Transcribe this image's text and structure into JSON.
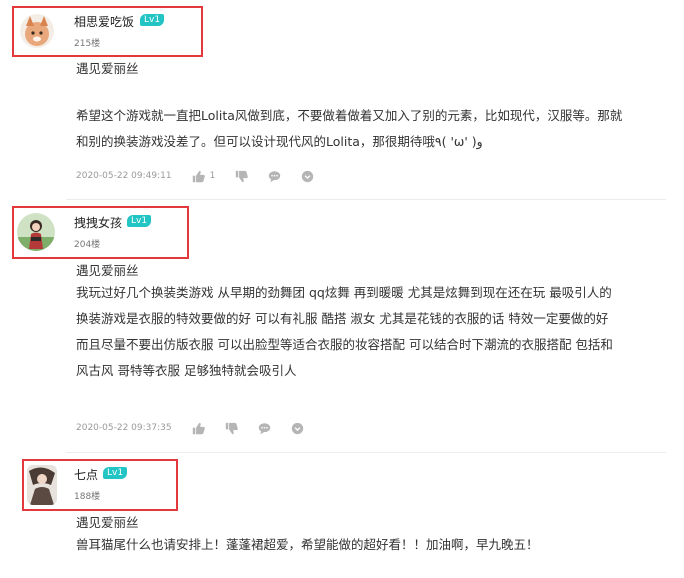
{
  "comments": [
    {
      "username": "相思爱吃饭",
      "level": "Lv1",
      "floor": "215楼",
      "tag": "遇见爱丽丝",
      "lines": [
        "希望这个游戏就一直把Lolita风做到底，不要做着做着又加入了别的元素，比如现代，汉服等。那就",
        "和别的换装游戏没差了。但可以设计现代风的Lolita，那很期待哦٩( 'ω' )و"
      ],
      "time": "2020-05-22 09:49:11",
      "likes": "1"
    },
    {
      "username": "拽拽女孩",
      "level": "Lv1",
      "floor": "204楼",
      "tag": "遇见爱丽丝",
      "lines": [
        "我玩过好几个换装类游戏 从早期的劲舞团 qq炫舞 再到暖暖 尤其是炫舞到现在还在玩 最吸引人的",
        "换装游戏是衣服的特效要做的好 可以有礼服 酷搭 淑女 尤其是花钱的衣服的话 特效一定要做的好",
        "而且尽量不要出仿版衣服 可以出脸型等适合衣服的妆容搭配 可以结合时下潮流的衣服搭配 包括和",
        "风古风 哥特等衣服 足够独特就会吸引人"
      ],
      "time": "2020-05-22 09:37:35",
      "likes": ""
    },
    {
      "username": "七点",
      "level": "Lv1",
      "floor": "188楼",
      "tag": "遇见爱丽丝",
      "lines": [
        " 兽耳猫尾什么也请安排上！蓬蓬裙超爱，希望能做的超好看！！加油啊，早九晚五！"
      ],
      "time": "",
      "likes": ""
    }
  ],
  "icons": {
    "like": "thumbs-up-icon",
    "dislike": "thumbs-down-icon",
    "reply": "chat-bubble-icon",
    "more": "more-circle-icon"
  },
  "colors": {
    "highlight_border": "#e4393c",
    "level_badge": "#22c4c4"
  }
}
